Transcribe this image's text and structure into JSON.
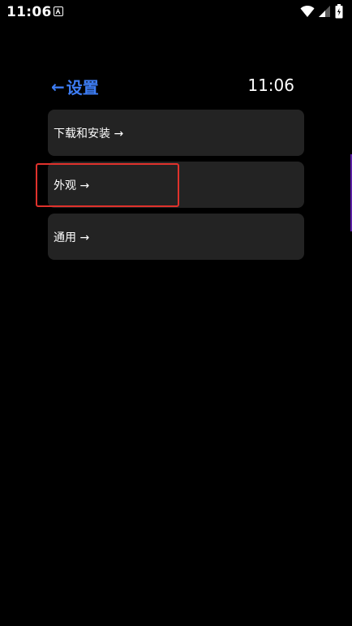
{
  "status_bar": {
    "time": "11:06",
    "icons": [
      "app-notification-icon",
      "wifi-icon",
      "signal-icon",
      "battery-icon"
    ]
  },
  "header": {
    "back_arrow": "←",
    "title": "设置",
    "clock": "11:06"
  },
  "menu": {
    "items": [
      {
        "label": "下载和安装 →"
      },
      {
        "label": "外观 →"
      },
      {
        "label": "通用 →"
      }
    ]
  },
  "colors": {
    "background": "#000000",
    "accent": "#3d7cf3",
    "card": "#232323",
    "highlight": "#e0322c"
  }
}
